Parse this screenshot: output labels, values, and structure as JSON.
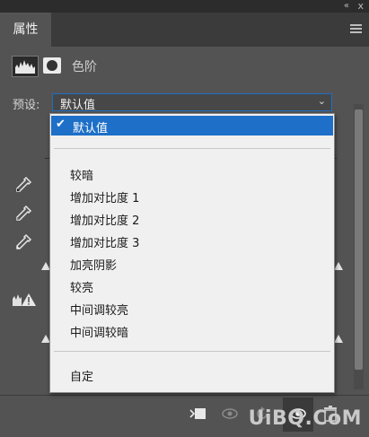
{
  "panel": {
    "tab_label": "属性",
    "title": "色阶",
    "preset_label": "预设:",
    "preset_value": "默认值",
    "caret": "⌄",
    "double_arrow": "«",
    "close": "x"
  },
  "dropdown": {
    "selected": "默认值",
    "checkmark": "✔",
    "items": [
      "较暗",
      "增加对比度 1",
      "增加对比度 2",
      "增加对比度 3",
      "加亮阴影",
      "较亮",
      "中间调较亮",
      "中间调较暗"
    ],
    "custom": "自定"
  },
  "watermark": "UiBQ.CoM",
  "colors": {
    "panel_bg": "#535353",
    "accent": "#1e6fc7",
    "dropdown_bg": "#f0f0f0"
  }
}
